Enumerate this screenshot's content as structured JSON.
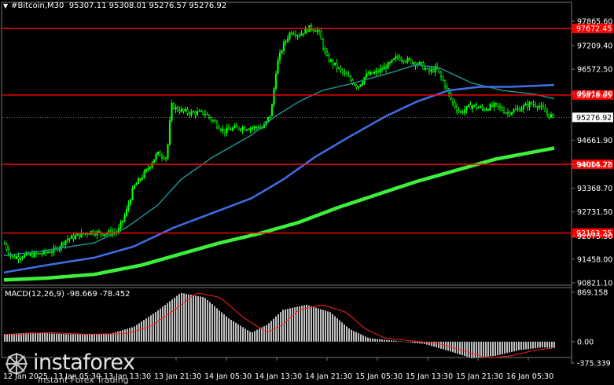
{
  "header": {
    "symbol": "#Bitcoin,M30",
    "ohlc": "95307.11 95308.01 95276.57 95276.92"
  },
  "macd": {
    "label": "MACD(12,26,9) -98.669 -78.452",
    "axis_labels": [
      "869.158",
      "0.00",
      "-375.339"
    ]
  },
  "price_axis": {
    "labels": [
      "97865.60",
      "97209.40",
      "96572.50",
      "95916.30",
      "94661.90",
      "94005.70",
      "93368.70",
      "92731.50",
      "92075.30",
      "91458.00",
      "90821.10"
    ],
    "current_price": "95276.92"
  },
  "levels": [
    {
      "value": "97672.45",
      "color": "#ff0000"
    },
    {
      "value": "95878.65",
      "color": "#ff0000"
    },
    {
      "value": "94014.22",
      "color": "#ff0000"
    },
    {
      "value": "92163.25",
      "color": "#ff0000"
    }
  ],
  "time_axis": {
    "labels": [
      "12 Jan 2025",
      "13 Jan 05:30",
      "13 Jan 13:30",
      "13 Jan 21:30",
      "14 Jan 05:30",
      "14 Jan 13:30",
      "14 Jan 21:30",
      "15 Jan 05:30",
      "15 Jan 13:30",
      "15 Jan 21:30",
      "16 Jan 05:30"
    ]
  },
  "watermark": {
    "brand": "instaforex",
    "tagline": "Instant Forex Trading"
  },
  "colors": {
    "background": "#000000",
    "candle": "#00ff00",
    "ma_fast": "#1c8f8f",
    "ma_mid": "#3f6fe8",
    "ma_slow": "#3cf03c",
    "level_line": "#ff0000",
    "macd_hist": "#c0c0c0",
    "macd_signal": "#ff2020",
    "axis_text": "#ffffff"
  }
}
